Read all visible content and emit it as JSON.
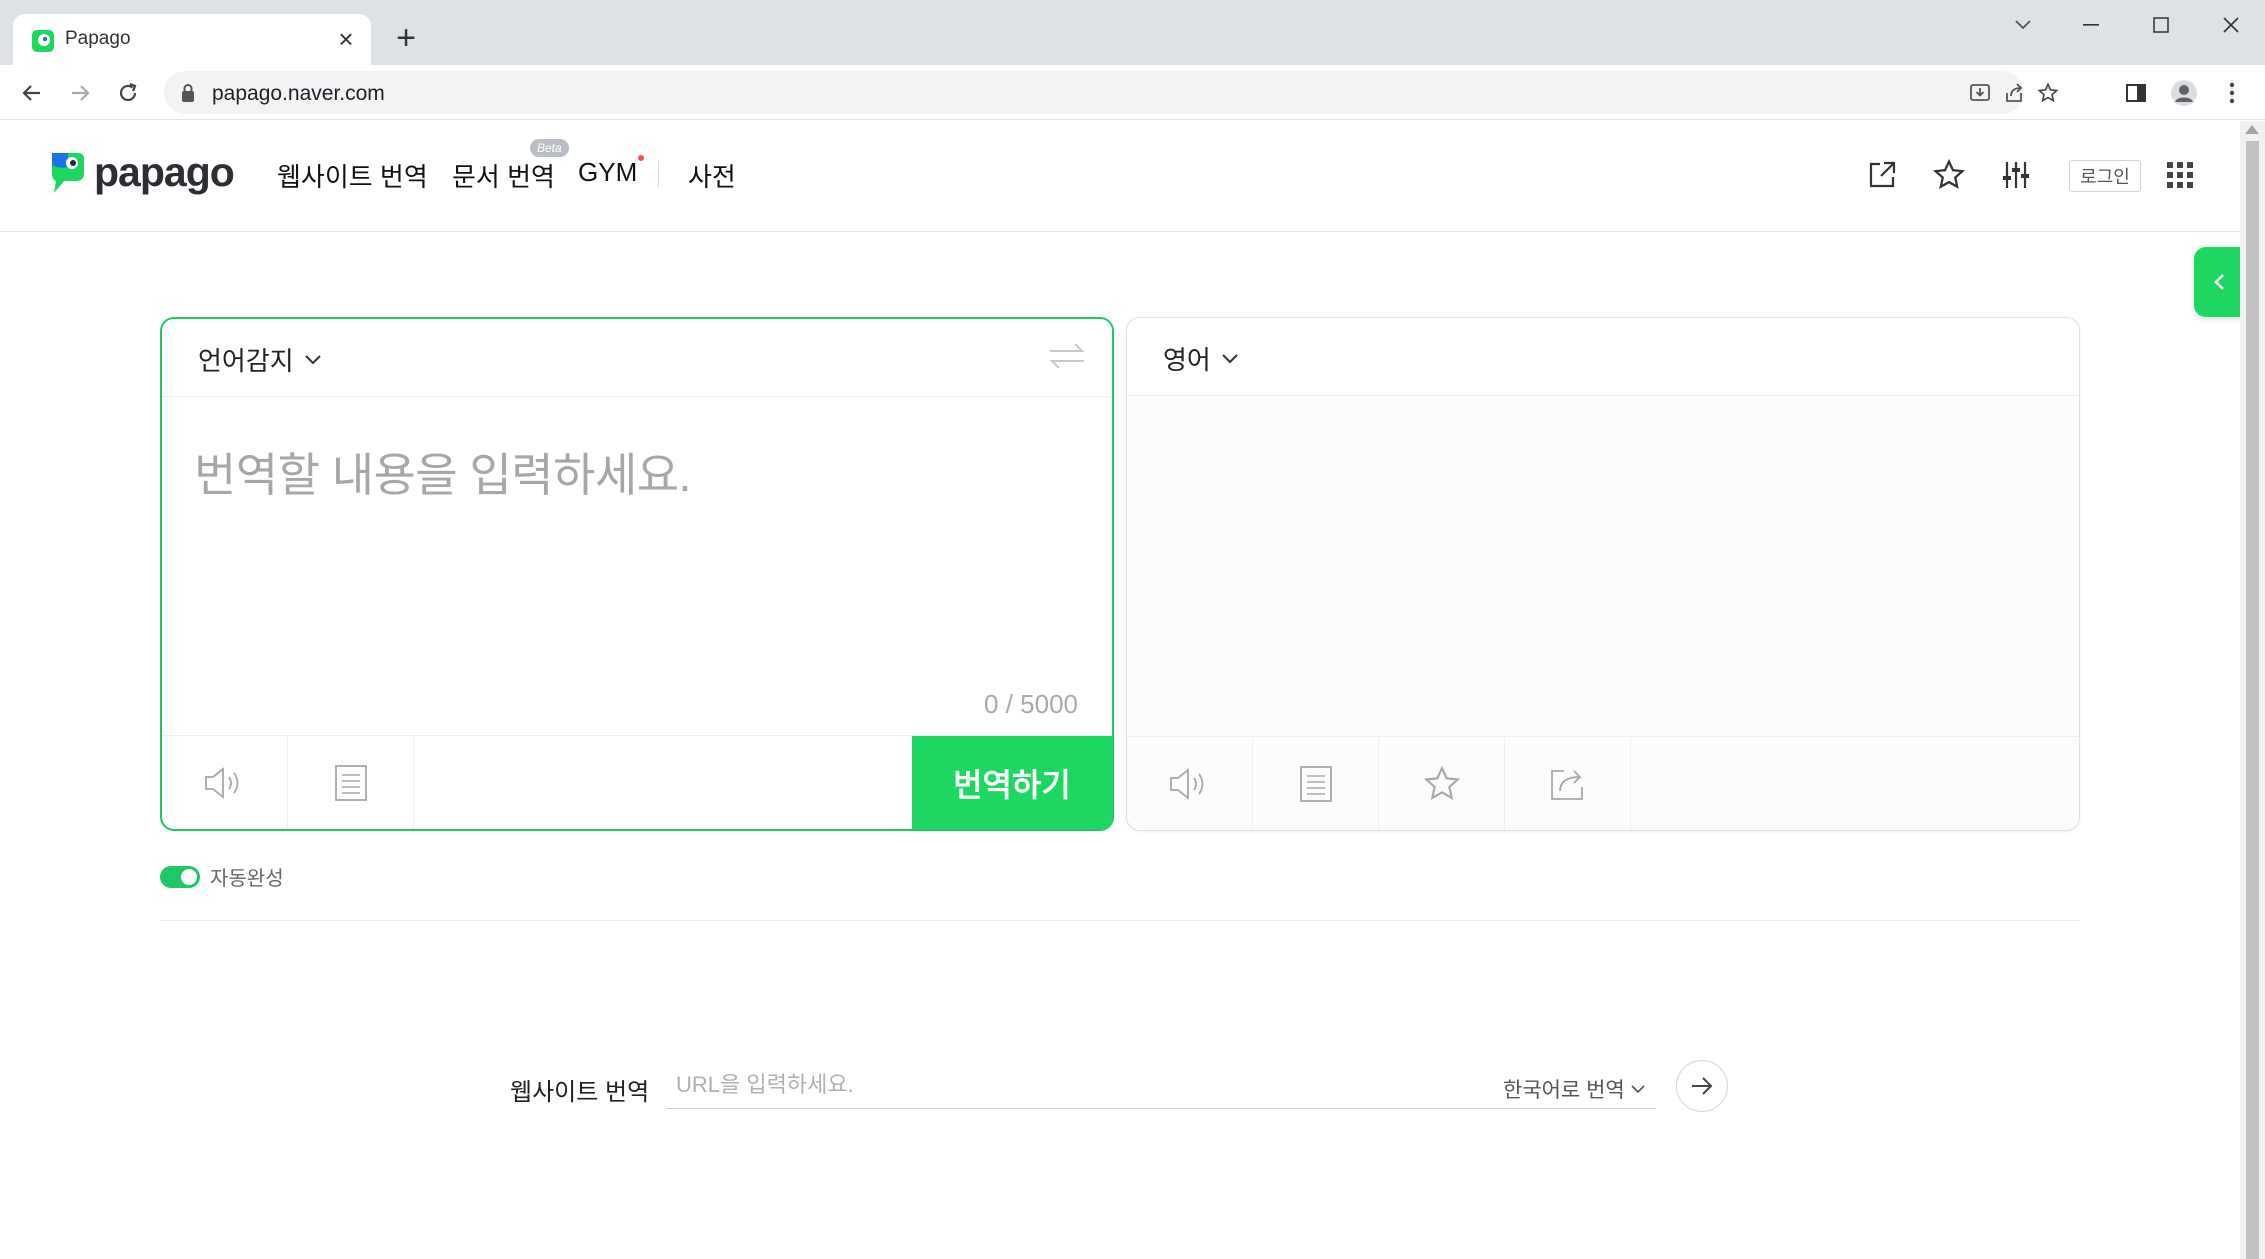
{
  "browser": {
    "tab_title": "Papago",
    "url": "papago.naver.com"
  },
  "header": {
    "logo_text": "papago",
    "nav": {
      "website": "웹사이트 번역",
      "document": "문서 번역",
      "beta": "Beta",
      "gym": "GYM",
      "dictionary": "사전"
    },
    "login": "로그인"
  },
  "source": {
    "language": "언어감지",
    "placeholder": "번역할 내용을 입력하세요.",
    "counter": "0 / 5000",
    "translate_button": "번역하기"
  },
  "target": {
    "language": "영어"
  },
  "autocomplete": {
    "label": "자동완성",
    "enabled": true
  },
  "website_translate": {
    "title": "웹사이트 번역",
    "placeholder": "URL을 입력하세요.",
    "to_language": "한국어로 번역"
  },
  "colors": {
    "brand_green": "#1ed760",
    "border_green": "#1ec864"
  }
}
